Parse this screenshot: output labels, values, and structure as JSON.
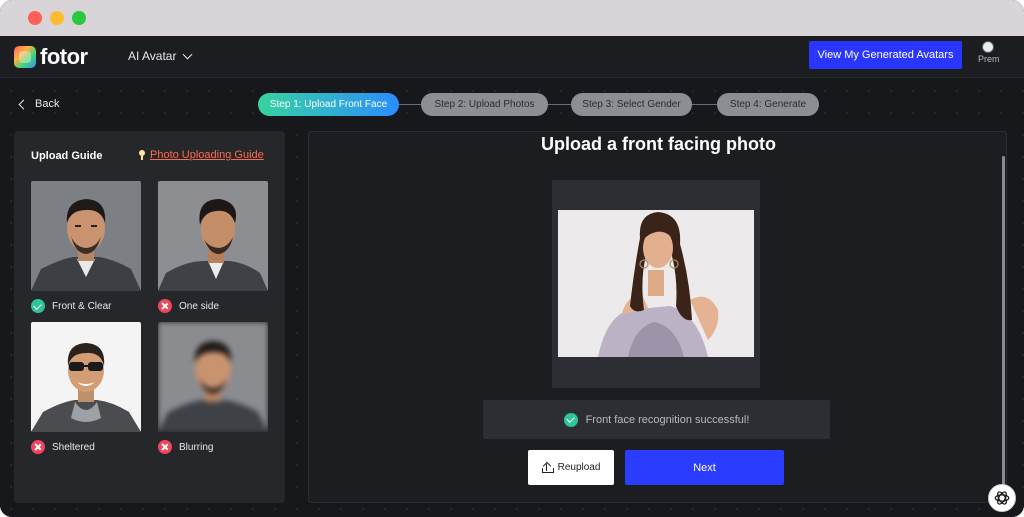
{
  "nav": {
    "brand": "fotor",
    "menu_label": "AI Avatar",
    "cta_label": "View My Generated Avatars",
    "user_name": "Prem"
  },
  "back_label": "Back",
  "steps": [
    {
      "label": "Step 1: Upload Front Face",
      "active": true
    },
    {
      "label": "Step 2: Upload Photos",
      "active": false
    },
    {
      "label": "Step 3: Select Gender",
      "active": false
    },
    {
      "label": "Step 4: Generate",
      "active": false
    }
  ],
  "guide": {
    "title": "Upload Guide",
    "link_label": "Photo Uploading Guide",
    "examples": [
      {
        "label": "Front & Clear",
        "status": "ok"
      },
      {
        "label": "One side",
        "status": "bad"
      },
      {
        "label": "Sheltered",
        "status": "bad"
      },
      {
        "label": "Blurring",
        "status": "bad"
      }
    ]
  },
  "main": {
    "title": "Upload a front facing photo",
    "status_text": "Front face recognition successful!",
    "reupload_label": "Reupload",
    "next_label": "Next"
  },
  "colors": {
    "accent_blue": "#2936ff",
    "success_green": "#2fc49a",
    "error_red": "#f0455c",
    "link_orange": "#ff6a4d"
  }
}
